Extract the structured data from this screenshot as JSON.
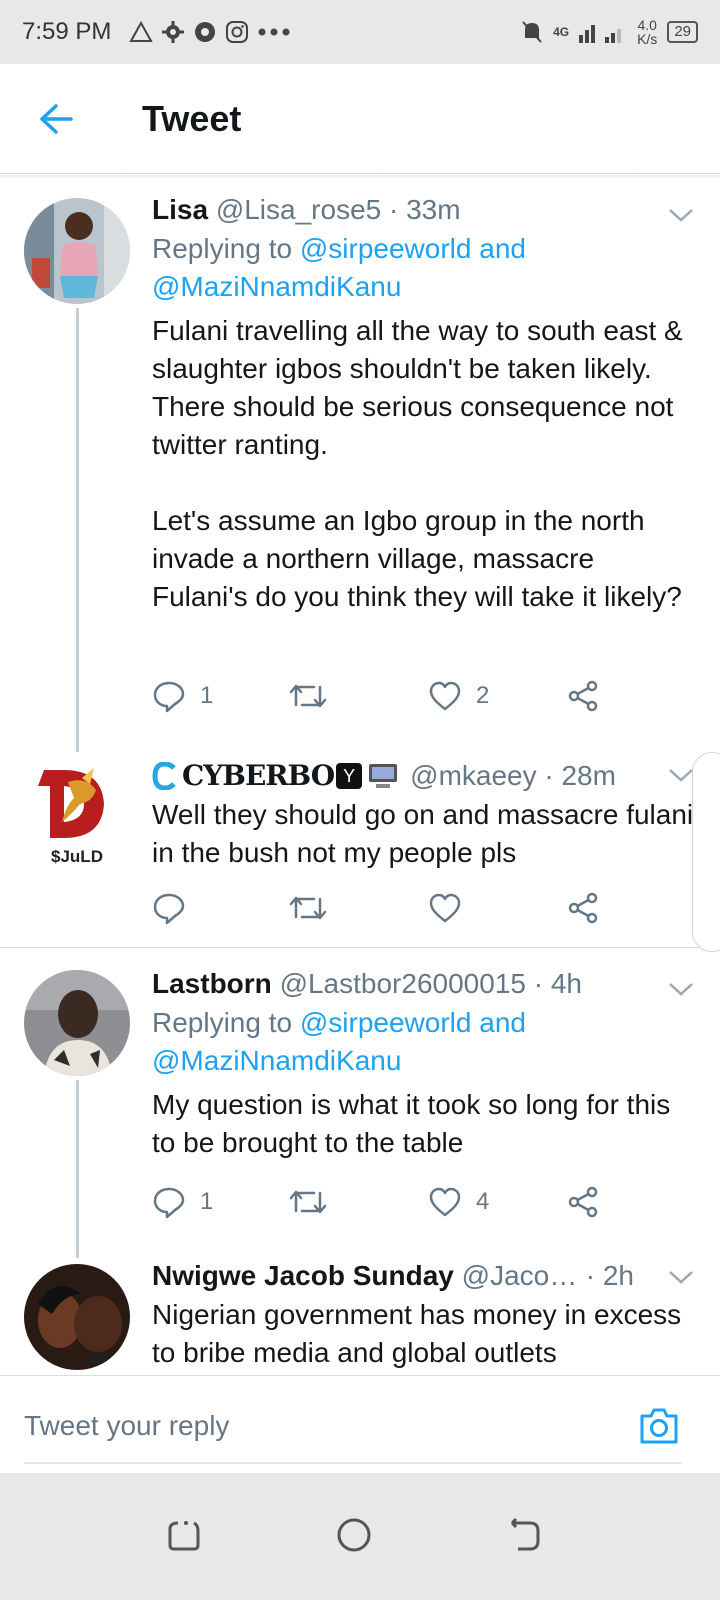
{
  "status_bar": {
    "time": "7:59 PM",
    "network_speed_top": "4.0",
    "network_speed_unit": "K/s",
    "signal_label": "4G",
    "battery": "29"
  },
  "header": {
    "title": "Tweet"
  },
  "tweets": [
    {
      "name": "Lisa",
      "handle": "@Lisa_rose5 · 33m",
      "replying_prefix": "Replying to ",
      "replying_mentions": "@sirpeeworld and @MaziNnamdiKanu",
      "text": "Fulani travelling all the way to south east & slaughter igbos shouldn't be taken likely. There should be serious consequence not twitter ranting.\n\nLet's assume an Igbo group in the north invade a northern village, massacre Fulani's do you think they will take it likely?",
      "replies": "1",
      "retweets": "",
      "likes": "2"
    },
    {
      "name": "CYBERBO",
      "name_badge": "Y",
      "handle": "@mkaeey · 28m",
      "avatar_label": "$JuLD",
      "text": "Well they should go on and massacre fulani  in the bush not my people pls",
      "replies": "",
      "retweets": "",
      "likes": ""
    },
    {
      "name": "Lastborn",
      "handle": "@Lastbor26000015 · 4h",
      "replying_prefix": "Replying to ",
      "replying_mentions": "@sirpeeworld and @MaziNnamdiKanu",
      "text": "My question is what it took so long for this to be brought to the table",
      "replies": "1",
      "retweets": "",
      "likes": "4"
    },
    {
      "name": "Nwigwe Jacob Sunday",
      "handle": "@Jaco…",
      "time": "· 2h",
      "text": "Nigerian government has money in excess to bribe media and global outlets"
    }
  ],
  "reply_bar": {
    "placeholder": "Tweet your reply"
  },
  "colors": {
    "accent": "#1da1f2",
    "text_primary": "#14171a",
    "text_secondary": "#657786",
    "divider": "#d9dde0"
  },
  "icons": [
    "back-arrow-icon",
    "chevron-down-icon",
    "reply-icon",
    "retweet-icon",
    "like-icon",
    "share-icon",
    "camera-icon",
    "recents-icon",
    "home-icon",
    "back-nav-icon"
  ]
}
